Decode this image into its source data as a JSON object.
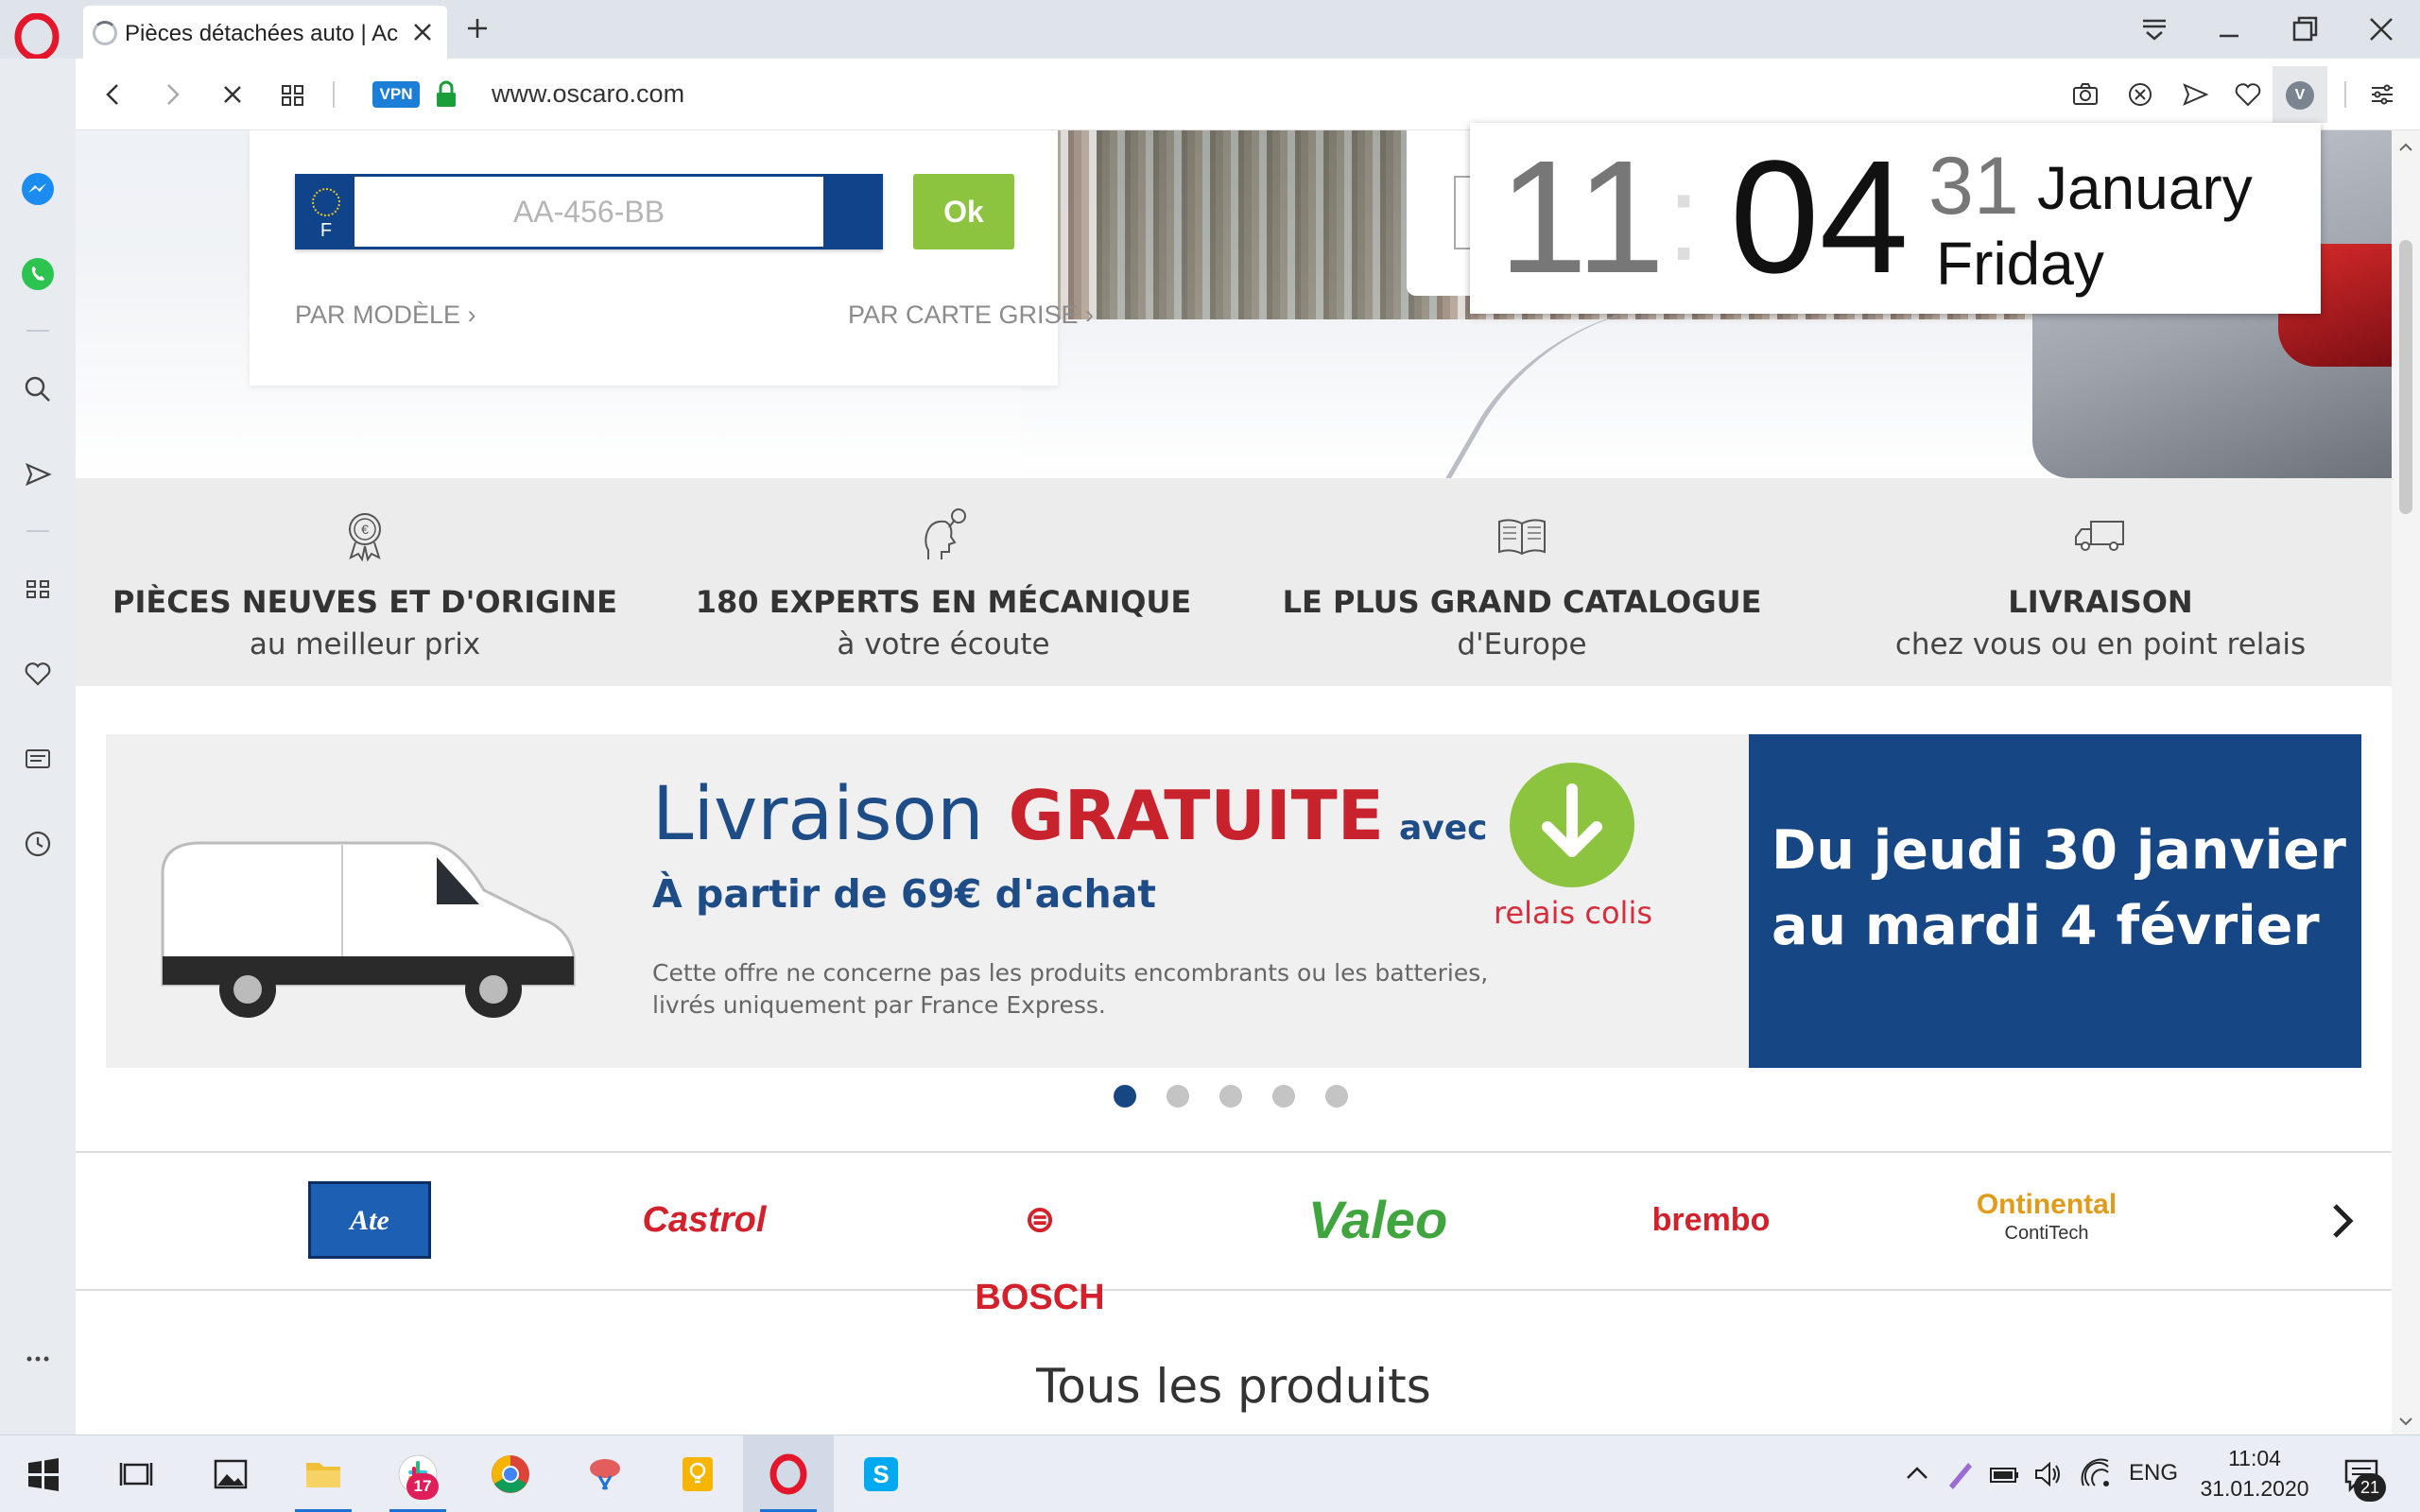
{
  "browser": {
    "tab_title": "Pièces détachées auto | Ach",
    "vpn_label": "VPN",
    "url": "www.oscaro.com",
    "extension_initial": "V"
  },
  "search": {
    "plate_placeholder": "AA-456-BB",
    "plate_country": "F",
    "ok_label": "Ok",
    "by_model_link": "PAR MODÈLE ›",
    "by_card_link": "PAR CARTE GRISE ›"
  },
  "features": [
    {
      "icon": "euro-medal-icon",
      "title": "PIÈCES NEUVES ET D'ORIGINE",
      "subtitle": "au meilleur prix"
    },
    {
      "icon": "mechanic-expert-icon",
      "title": "180 EXPERTS EN MÉCANIQUE",
      "subtitle": "à votre écoute"
    },
    {
      "icon": "open-book-icon",
      "title": "LE PLUS GRAND CATALOGUE",
      "subtitle": "d'Europe"
    },
    {
      "icon": "delivery-truck-icon",
      "title": "LIVRAISON",
      "subtitle": "chez vous ou en point relais"
    }
  ],
  "banner": {
    "headline_livraison": "Livraison",
    "headline_gratuite": "GRATUITE",
    "headline_avec": "avec",
    "subheadline": "À partir de 69€ d'achat",
    "note": "Cette offre ne concerne pas les produits encombrants ou les batteries, livrés uniquement par France Express.",
    "partner": "relais colis",
    "dates_line1": "Du jeudi 30 janvier",
    "dates_line2": "au mardi 4 février"
  },
  "carousel": {
    "total_slides": 5,
    "active_slide": 1
  },
  "brands": {
    "ate": "Ate",
    "castrol": "Castrol",
    "bosch": "⊜ BOSCH",
    "valeo": "Valeo",
    "brembo": "brembo",
    "continental": "Ontinental",
    "continental_sub": "ContiTech"
  },
  "section_title": "Tous les produits",
  "clock": {
    "hours": "11",
    "minutes": "04",
    "day": "31",
    "month": "January",
    "weekday": "Friday"
  },
  "taskbar": {
    "slack_badge": "17",
    "language": "ENG",
    "time": "11:04",
    "date": "31.01.2020",
    "notifications": "21"
  },
  "colors": {
    "brand_blue": "#174684",
    "ok_green": "#8cc43f",
    "promo_red": "#c8222d",
    "opera_red": "#e3162b"
  }
}
